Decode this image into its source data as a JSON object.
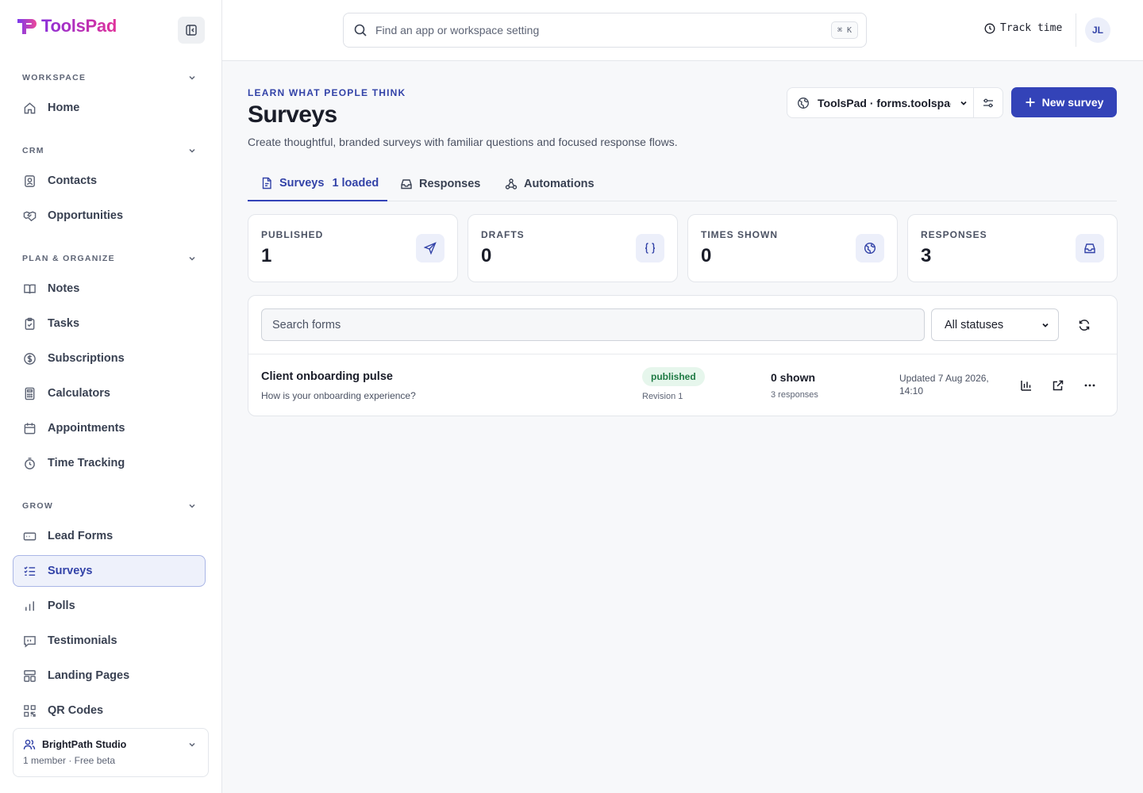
{
  "app": {
    "name": "ToolsPad"
  },
  "sidebar": {
    "sections": [
      {
        "label": "WORKSPACE"
      },
      {
        "label": "CRM"
      },
      {
        "label": "PLAN & ORGANIZE"
      },
      {
        "label": "GROW"
      }
    ],
    "items": [
      {
        "label": "Home",
        "icon": "home-icon"
      },
      {
        "label": "Contacts",
        "icon": "contacts-icon"
      },
      {
        "label": "Opportunities",
        "icon": "handshake-icon"
      },
      {
        "label": "Notes",
        "icon": "book-icon"
      },
      {
        "label": "Tasks",
        "icon": "clipboard-check-icon"
      },
      {
        "label": "Subscriptions",
        "icon": "dollar-circle-icon"
      },
      {
        "label": "Calculators",
        "icon": "calculator-icon"
      },
      {
        "label": "Appointments",
        "icon": "calendar-icon"
      },
      {
        "label": "Time Tracking",
        "icon": "stopwatch-icon"
      },
      {
        "label": "Lead Forms",
        "icon": "form-icon"
      },
      {
        "label": "Surveys",
        "icon": "checklist-icon",
        "active": true
      },
      {
        "label": "Polls",
        "icon": "bar-chart-icon"
      },
      {
        "label": "Testimonials",
        "icon": "message-quote-icon"
      },
      {
        "label": "Landing Pages",
        "icon": "layout-icon"
      },
      {
        "label": "QR Codes",
        "icon": "qr-code-icon"
      }
    ],
    "org": {
      "name": "BrightPath Studio",
      "meta": "1 member · Free beta"
    }
  },
  "topbar": {
    "search_placeholder": "Find an app or workspace setting",
    "shortcut": "⌘ K",
    "track_label": "Track time",
    "avatar_initials": "JL"
  },
  "header": {
    "eyebrow": "LEARN WHAT PEOPLE THINK",
    "title": "Surveys",
    "description": "Create thoughtful, branded surveys with familiar questions and focused response flows.",
    "workspace_select": "ToolsPad · forms.toolspad",
    "new_button": "New survey"
  },
  "tabs": [
    {
      "label": "Surveys",
      "count": "1 loaded",
      "active": true
    },
    {
      "label": "Responses"
    },
    {
      "label": "Automations"
    }
  ],
  "stats": [
    {
      "label": "PUBLISHED",
      "value": "1",
      "icon": "send-icon"
    },
    {
      "label": "DRAFTS",
      "value": "0",
      "icon": "braces-icon"
    },
    {
      "label": "TIMES SHOWN",
      "value": "0",
      "icon": "globe-icon"
    },
    {
      "label": "RESPONSES",
      "value": "3",
      "icon": "inbox-icon"
    }
  ],
  "list": {
    "search_placeholder": "Search forms",
    "status_filter": "All statuses",
    "rows": [
      {
        "title": "Client onboarding pulse",
        "question": "How is your onboarding experience?",
        "status": "published",
        "revision": "Revision 1",
        "shown": "0 shown",
        "responses": "3 responses",
        "updated": "Updated 7 Aug 2026, 14:10"
      }
    ]
  },
  "colors": {
    "accent": "#3343b8",
    "published_bg": "#e6f6ec",
    "published_text": "#1e7a44"
  }
}
